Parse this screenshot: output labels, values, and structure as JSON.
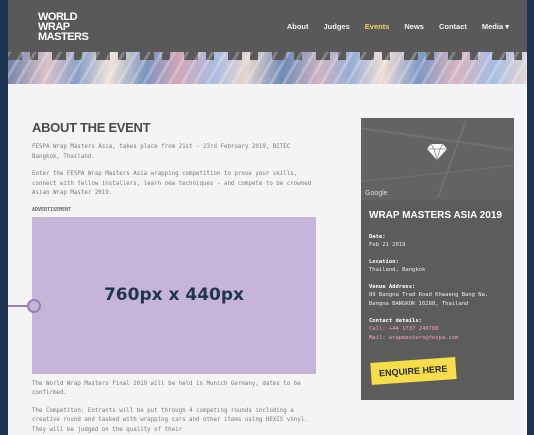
{
  "logo": {
    "line1": "WORLD",
    "line2": "WRAP",
    "line3": "MASTERS"
  },
  "nav": {
    "about": "About",
    "judges": "Judges",
    "events": "Events",
    "news": "News",
    "contact": "Contact",
    "media": "Media ▾"
  },
  "main": {
    "title": "ABOUT THE EVENT",
    "p1": "FESPA Wrap Masters Asia, takes place from 21st - 23rd February 2019, BITEC Bangkok, Thailand.",
    "p2": "Enter the FESPA Wrap Masters Asia wrapping competition to prove your skills, connect with fellow installers, learn new techniques - and compete to be crowned Asian Wrap Master 2019.",
    "ad_label": "ADVERTISEMENT",
    "ad_text": "760px x 440px",
    "p3": "The World Wrap Masters Final 2019 will be held in Munich Germany, dates to be confirmed.",
    "p4": "The Competiton: Entrants will be put through 4 competing rounds including a creative round and tasked with wrapping cars and other items using HEXIS vinyl. They will be judged on the quality of their"
  },
  "sidebar": {
    "map_brand": "Google",
    "title": "WRAP MASTERS ASIA 2019",
    "date_label": "Date:",
    "date": "Feb 21 2019",
    "location_label": "Location:",
    "location": "Thailand, Bangkok",
    "venue_label": "Venue Address:",
    "venue": "89 Bangna Trad Road Khwaeng Bang Na, Bangna BANGKOK 10260, Thailand",
    "contact_label": "Contact details:",
    "call": "Call: +44 1737 240788",
    "mail": "Mail: wrapmasters@fespa.com",
    "enquire": "ENQUIRE HERE"
  }
}
